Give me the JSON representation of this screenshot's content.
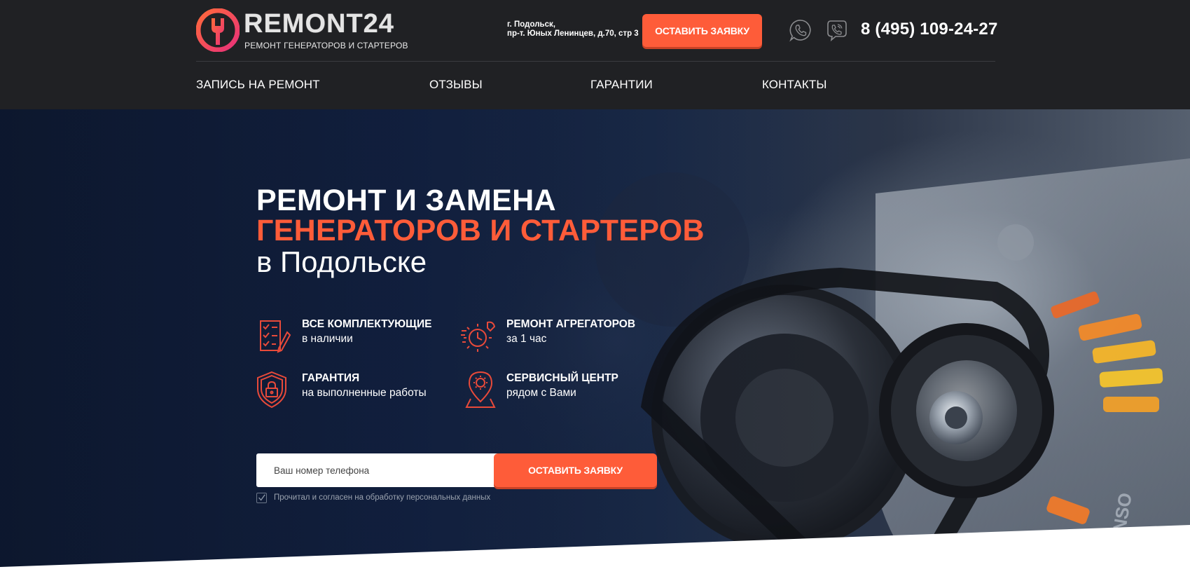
{
  "colors": {
    "accent": "#fe5c39",
    "header_bg": "#202124",
    "hero_bg": "#142447",
    "text": "#ffffff"
  },
  "header": {
    "logo_title": "REMONT24",
    "logo_subtitle": "РЕМОНТ ГЕНЕРАТОРОВ И СТАРТЕРОВ",
    "address_line1": "г. Подольск,",
    "address_line2": "пр-т. Юных Ленинцев, д.70, стр 3",
    "cta_label": "ОСТАВИТЬ ЗАЯВКУ",
    "messenger_icons": [
      "whatsapp-icon",
      "viber-icon"
    ],
    "phone": "8 (495) 109-24-27"
  },
  "nav": {
    "items": [
      {
        "label": "ЗАПИСЬ НА РЕМОНТ"
      },
      {
        "label": "ОТЗЫВЫ"
      },
      {
        "label": "ГАРАНТИИ"
      },
      {
        "label": "КОНТАКТЫ"
      }
    ]
  },
  "hero": {
    "title_line1": "РЕМОНТ И ЗАМЕНА",
    "title_line2": "ГЕНЕРАТОРОВ И СТАРТЕРОВ",
    "title_line3": "в Подольске",
    "features": [
      {
        "icon": "checklist-icon",
        "title": "ВСЕ КОМПЛЕКТУЮЩИЕ",
        "subtitle": "в наличии"
      },
      {
        "icon": "gear-clock-icon",
        "title": "РЕМОНТ АГРЕГАТОРОВ",
        "subtitle": "за 1 час"
      },
      {
        "icon": "shield-lock-icon",
        "title": "ГАРАНТИЯ",
        "subtitle": "на выполненные работы"
      },
      {
        "icon": "location-gear-icon",
        "title": "СЕРВИСНЫЙ ЦЕНТР",
        "subtitle": "рядом с Вами"
      }
    ],
    "form": {
      "phone_placeholder": "Ваш номер телефона",
      "phone_value": "",
      "submit_label": "ОСТАВИТЬ ЗАЯВКУ",
      "consent_checked": true,
      "consent_text": "Прочитал и согласен на обработку персональных данных"
    }
  }
}
